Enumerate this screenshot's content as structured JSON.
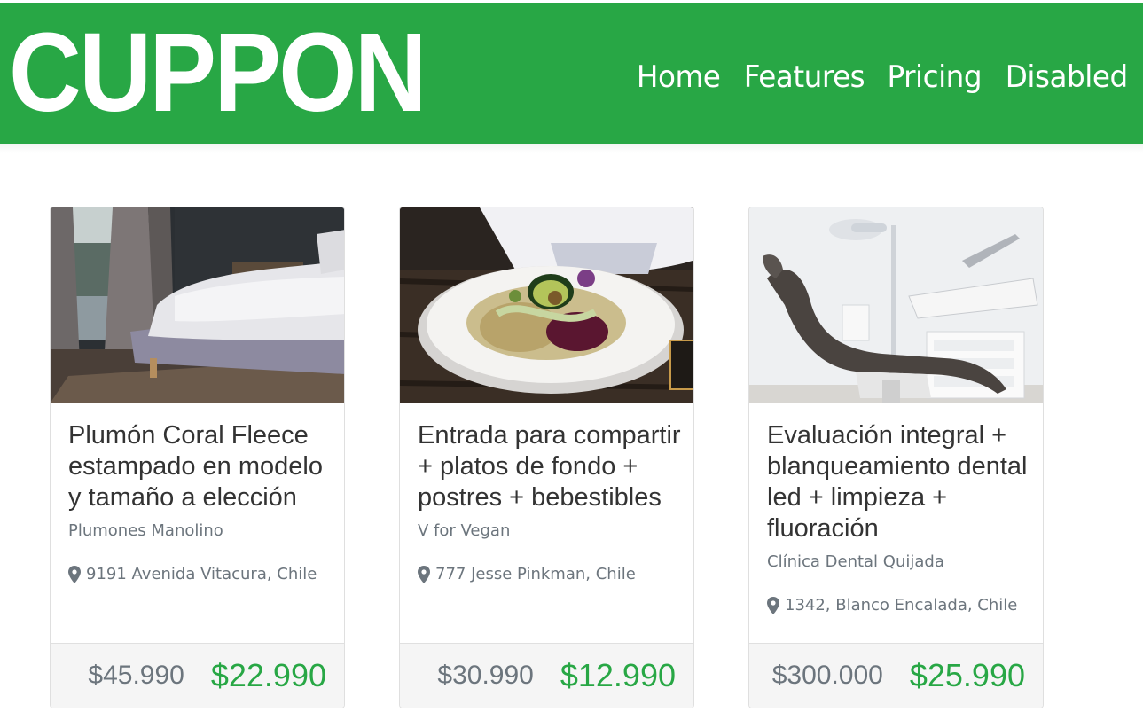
{
  "navbar": {
    "brand": "CUPPON",
    "links": [
      {
        "label": "Home"
      },
      {
        "label": "Features"
      },
      {
        "label": "Pricing"
      },
      {
        "label": "Disabled"
      }
    ],
    "colors": {
      "background": "#28a745",
      "text": "#ffffff"
    }
  },
  "cards": [
    {
      "image": "bedroom-photo",
      "title": "Plumón Coral Fleece estampado en modelo y tamaño a elección",
      "merchant": "Plumones Manolino",
      "location_icon": "map-marker-icon",
      "location": "9191 Avenida Vitacura, Chile",
      "old_price": "$45.990",
      "new_price": "$22.990"
    },
    {
      "image": "vegan-salad-photo",
      "title": "Entrada para compartir + platos de fondo + postres + bebestibles",
      "merchant": "V for Vegan",
      "location_icon": "map-marker-icon",
      "location": "777 Jesse Pinkman, Chile",
      "old_price": "$30.990",
      "new_price": "$12.990"
    },
    {
      "image": "dental-chair-photo",
      "title": "Evaluación integral + blanqueamiento dental led + limpieza + fluoración",
      "merchant": "Clínica Dental Quijada",
      "location_icon": "map-marker-icon",
      "location": "1342, Blanco Encalada, Chile",
      "old_price": "$300.000",
      "new_price": "$25.990"
    }
  ],
  "colors": {
    "price_new": "#28a745",
    "muted": "#6c757d"
  }
}
